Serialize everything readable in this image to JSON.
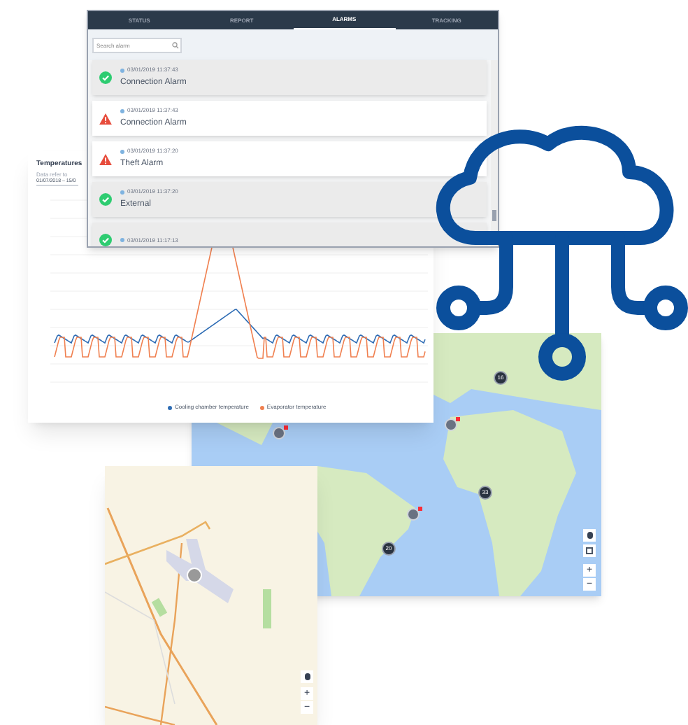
{
  "alarm_panel": {
    "tabs": [
      {
        "label": "STATUS",
        "selected": false
      },
      {
        "label": "REPORT",
        "selected": false
      },
      {
        "label": "ALARMS",
        "selected": true
      },
      {
        "label": "TRACKING",
        "selected": false
      }
    ],
    "search": {
      "placeholder": "Search alarm"
    },
    "alarms": [
      {
        "kind": "ok",
        "timestamp": "03/01/2019 11:37:43",
        "title": "Connection Alarm"
      },
      {
        "kind": "warning",
        "timestamp": "03/01/2019 11:37:43",
        "title": "Connection Alarm"
      },
      {
        "kind": "warning",
        "timestamp": "03/01/2019 11:37:20",
        "title": "Theft Alarm"
      },
      {
        "kind": "ok",
        "timestamp": "03/01/2019 11:37:20",
        "title": "External"
      },
      {
        "kind": "ok",
        "timestamp": "03/01/2019 11:17:13"
      }
    ]
  },
  "chart_panel": {
    "title": "Temperatures",
    "subtitle": "Data refer to",
    "date_range": "01/07/2018 – 15/0",
    "legend": [
      {
        "name": "Cooling chamber temperature",
        "color": "#2f6db5"
      },
      {
        "name": "Evaporator temperature",
        "color": "#f08050"
      }
    ]
  },
  "world_map": {
    "clusters": [
      {
        "count": "16"
      },
      {
        "count": "33"
      },
      {
        "count": "20"
      }
    ],
    "zoom_controls": [
      "+",
      "−"
    ]
  },
  "local_map": {
    "zoom_controls": [
      "+",
      "−"
    ]
  }
}
